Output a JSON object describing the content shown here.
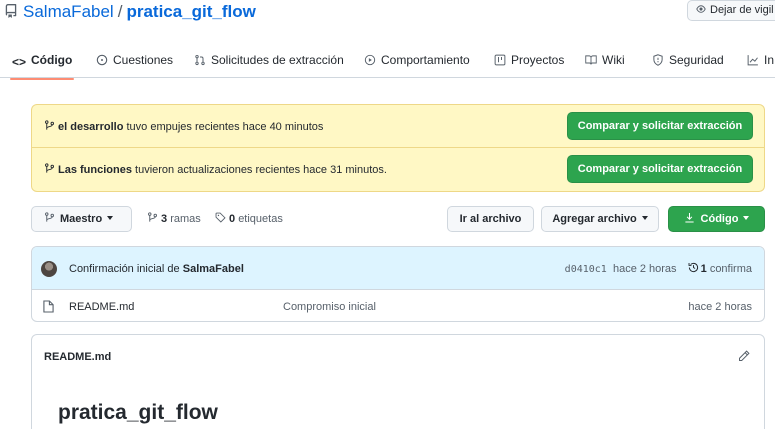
{
  "repo": {
    "owner": "SalmaFabel",
    "separator": "/",
    "name": "pratica_git_flow",
    "watch_label": "Dejar de vigil"
  },
  "tabs": [
    {
      "label": "Código",
      "icon": "code-icon",
      "active": true
    },
    {
      "label": "Cuestiones",
      "icon": "issue-icon",
      "active": false
    },
    {
      "label": "Solicitudes de extracción",
      "icon": "pull-request-icon",
      "active": false
    },
    {
      "label": "Comportamiento",
      "icon": "play-icon",
      "active": false
    },
    {
      "label": "Proyectos",
      "icon": "table-icon",
      "active": false
    },
    {
      "label": "Wiki",
      "icon": "book-icon",
      "active": false
    },
    {
      "label": "Seguridad",
      "icon": "shield-icon",
      "active": false
    },
    {
      "label": "In",
      "icon": "graph-icon",
      "active": false
    }
  ],
  "notices": [
    {
      "branch": "el desarrollo",
      "text": "tuvo empujes recientes hace 40 minutos",
      "button": "Comparar y solicitar extracción"
    },
    {
      "branch": "Las funciones",
      "text": "tuvieron actualizaciones recientes hace 31 minutos.",
      "button": "Comparar y solicitar extracción"
    }
  ],
  "branch_bar": {
    "branch_label": "Maestro",
    "branches_count": "3",
    "branches_label": "ramas",
    "tags_count": "0",
    "tags_label": "etiquetas",
    "go_to_file": "Ir al archivo",
    "add_file": "Agregar archivo",
    "code_button": "Código"
  },
  "commit": {
    "message": "Confirmación inicial de",
    "author": "SalmaFabel",
    "sha": "d0410c1",
    "age": "hace 2 horas",
    "commits_count": "1",
    "commits_label": "confirma"
  },
  "files": [
    {
      "name": "README.md",
      "commit_message": "Compromiso inicial",
      "age": "hace 2 horas"
    }
  ],
  "readme": {
    "filename": "README.md",
    "title": "pratica_git_flow"
  },
  "colors": {
    "accent": "#0969da",
    "green": "#2da44e",
    "notice_bg": "#fff8c5",
    "commit_bg": "#ddf4ff",
    "tab_underline": "#fd8c73"
  }
}
